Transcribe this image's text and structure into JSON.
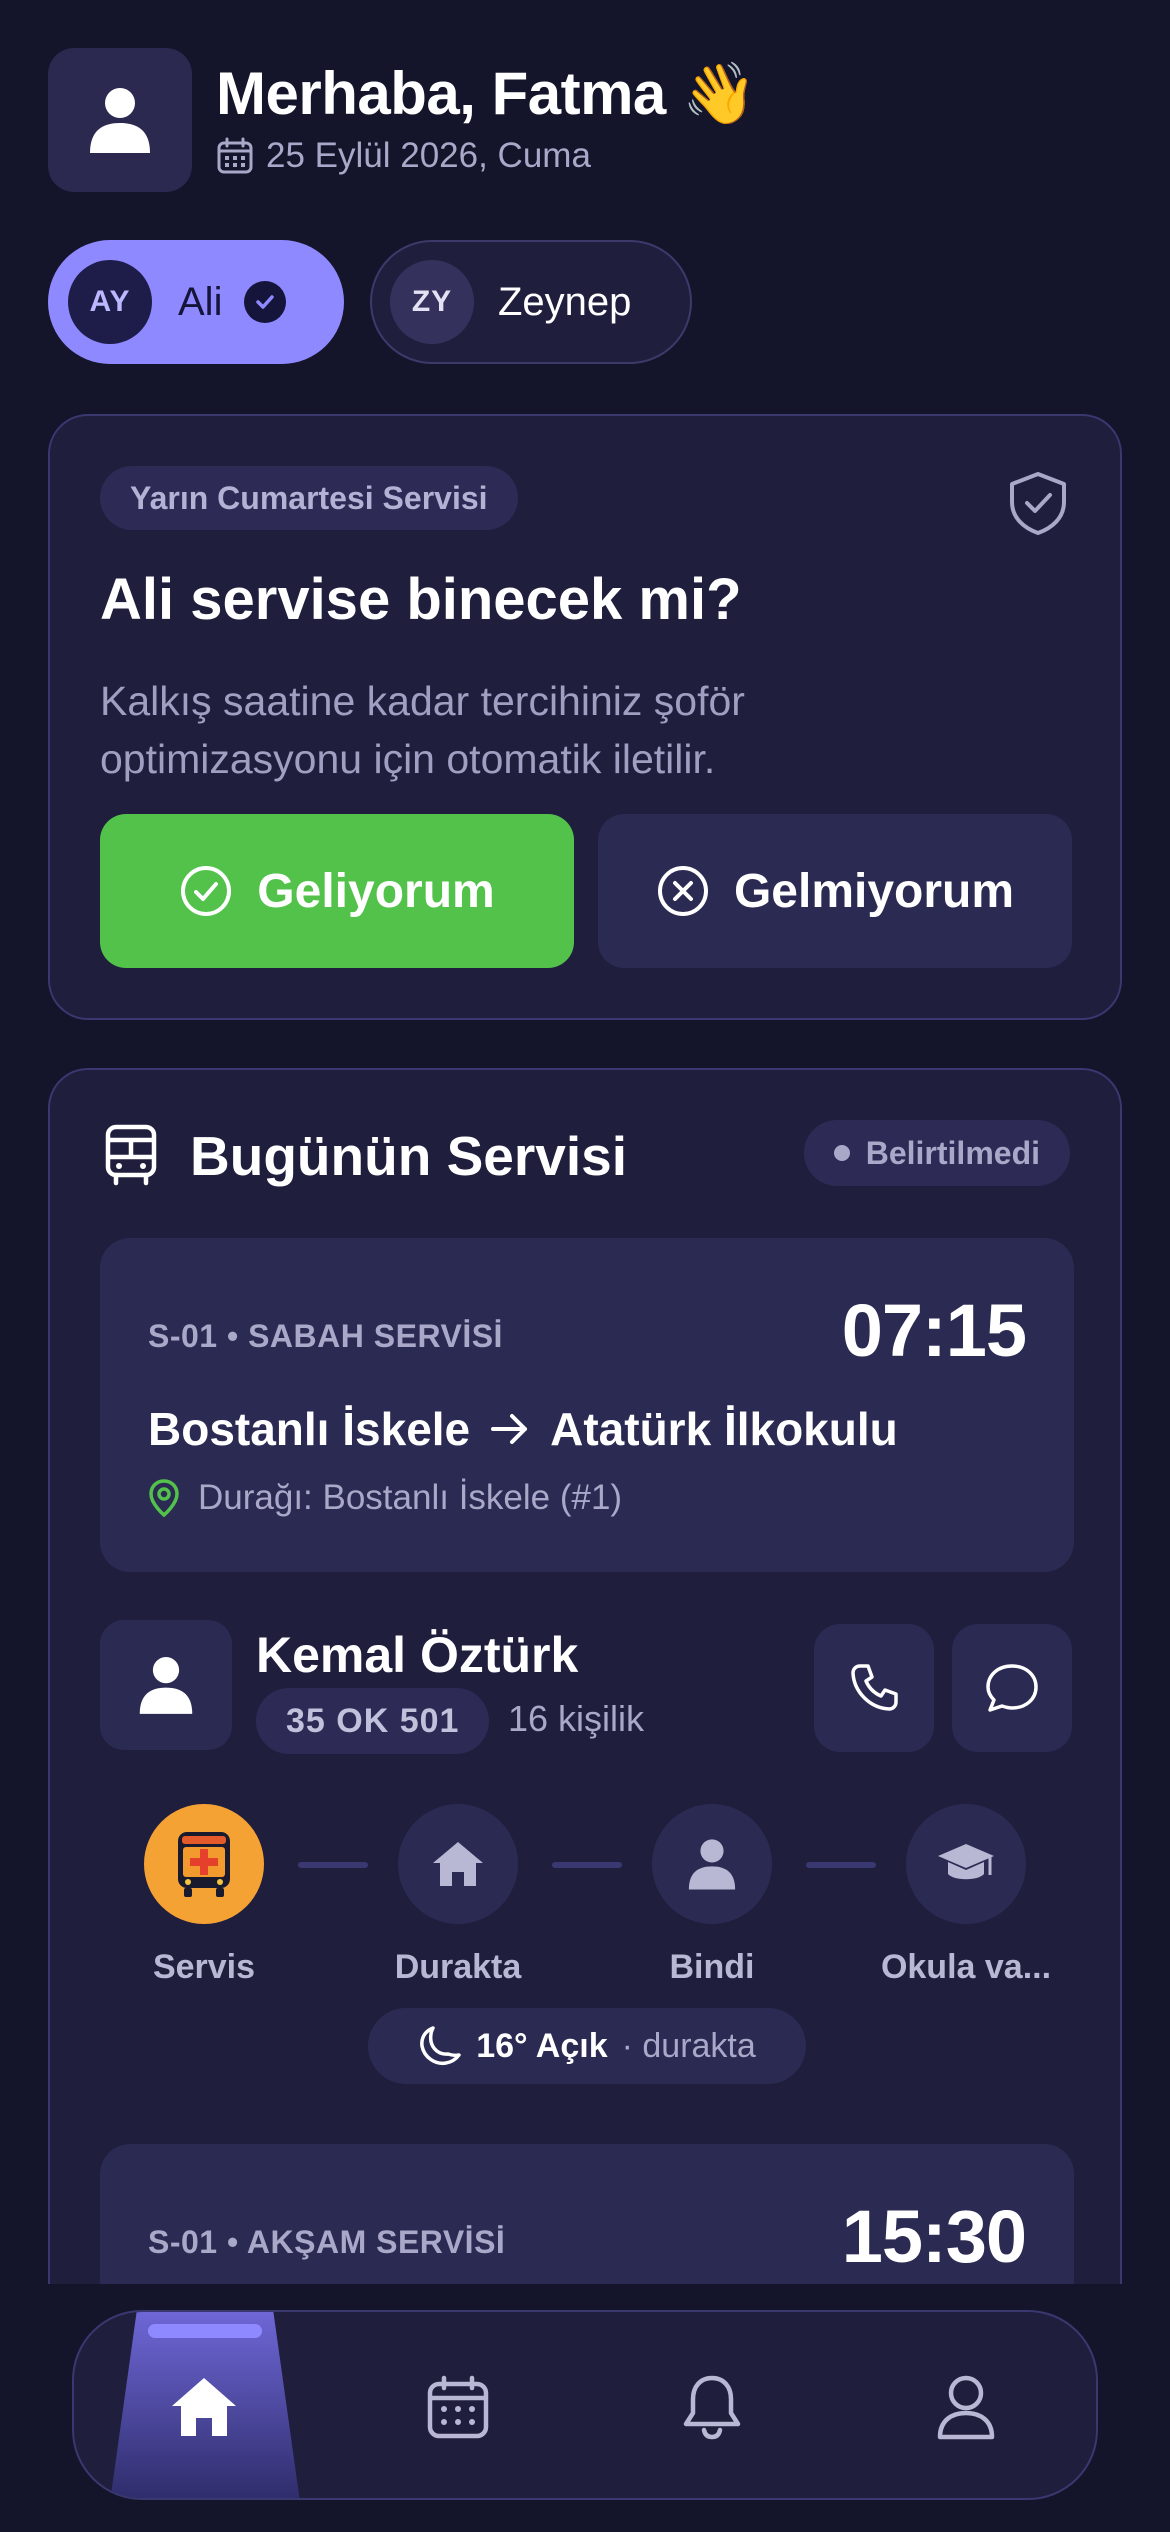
{
  "header": {
    "greeting": "Merhaba, Fatma",
    "wave_emoji": "👋",
    "date": "25 Eylül 2026, Cuma"
  },
  "children": [
    {
      "initials": "AY",
      "name": "Ali",
      "selected": true
    },
    {
      "initials": "ZY",
      "name": "Zeynep",
      "selected": false
    }
  ],
  "attendance_card": {
    "tag": "Yarın Cumartesi Servisi",
    "question": "Ali servise binecek mi?",
    "description": "Kalkış saatine kadar tercihiniz şoför optimizasyonu için otomatik iletilir.",
    "yes_label": "Geliyorum",
    "no_label": "Gelmiyorum"
  },
  "today": {
    "title": "Bugünün Servisi",
    "status": "Belirtilmedi",
    "morning": {
      "code": "S-01 • SABAH SERVİSİ",
      "time": "07:15",
      "from": "Bostanlı İskele",
      "to": "Atatürk İlkokulu",
      "stop": "Durağı: Bostanlı İskele (#1)"
    },
    "driver": {
      "name": "Kemal Öztürk",
      "plate": "35 OK 501",
      "capacity": "16 kişilik"
    },
    "steps": [
      {
        "label": "Servis",
        "icon": "bus-icon",
        "active": true
      },
      {
        "label": "Durakta",
        "icon": "home-icon",
        "active": false
      },
      {
        "label": "Bindi",
        "icon": "person-icon",
        "active": false
      },
      {
        "label": "Okula va...",
        "icon": "graduation-cap-icon",
        "active": false
      }
    ],
    "weather": {
      "temp": "16° Açık",
      "sub": "· durakta"
    },
    "evening": {
      "code": "S-01 • AKŞAM SERVİSİ",
      "time": "15:30"
    }
  },
  "nav": {
    "items": [
      "home-icon",
      "calendar-icon",
      "bell-icon",
      "profile-icon"
    ],
    "active": "home-icon"
  },
  "colors": {
    "background": "#14142a",
    "card": "#1f1e3d",
    "accent": "#8f89ff",
    "success": "#52c24b",
    "warning": "#f5a235"
  }
}
